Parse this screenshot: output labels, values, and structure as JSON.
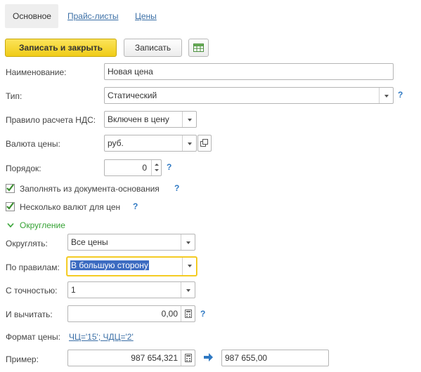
{
  "tabs": [
    {
      "label": "Основное"
    },
    {
      "label": "Прайс-листы"
    },
    {
      "label": "Цены"
    }
  ],
  "toolbar": {
    "save_close": "Записать и закрыть",
    "save": "Записать",
    "table_icon": "spreadsheet-icon"
  },
  "fields": {
    "name": {
      "label": "Наименование:",
      "value": "Новая цена"
    },
    "type": {
      "label": "Тип:",
      "value": "Статический"
    },
    "vat": {
      "label": "Правило расчета НДС:",
      "value": "Включен в цену"
    },
    "currency": {
      "label": "Валюта цены:",
      "value": "руб."
    },
    "order": {
      "label": "Порядок:",
      "value": "0"
    },
    "fill_from_doc": {
      "label": "Заполнять из документа-основания",
      "checked": true
    },
    "multi_currency": {
      "label": "Несколько валют для цен",
      "checked": true
    }
  },
  "help_mark": "?",
  "rounding": {
    "title": "Округление",
    "round": {
      "label": "Округлять:",
      "value": "Все цены"
    },
    "rule": {
      "label": "По правилам:",
      "value": "В большую сторону"
    },
    "precision": {
      "label": "С точностью:",
      "value": "1"
    },
    "subtract": {
      "label": "И вычитать:",
      "value": "0,00"
    },
    "format": {
      "label": "Формат цены:",
      "value": "ЧЦ='15'; ЧДЦ='2'"
    },
    "example": {
      "label": "Пример:",
      "input": "987 654,321",
      "output": "987 655,00"
    }
  },
  "colors": {
    "accent_yellow": "#f0cc17",
    "link_blue": "#3b6fa6",
    "section_green": "#36a335",
    "selection_blue": "#3c6bc1"
  }
}
